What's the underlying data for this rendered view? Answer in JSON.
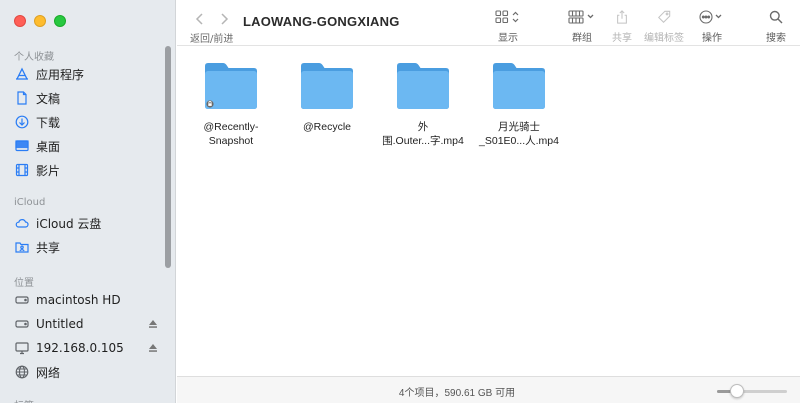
{
  "window": {
    "title": "LAOWANG-GONGXIANG",
    "nav_label": "返回/前进"
  },
  "toolbar": {
    "view_label": "显示",
    "group_label": "群组",
    "share_label": "共享",
    "tags_label": "编辑标签",
    "action_label": "操作",
    "search_label": "搜索"
  },
  "sidebar": {
    "favorites_header": "个人收藏",
    "favorites": [
      {
        "label": "应用程序",
        "icon": "applications-icon"
      },
      {
        "label": "文稿",
        "icon": "document-icon"
      },
      {
        "label": "下载",
        "icon": "downloads-icon"
      },
      {
        "label": "桌面",
        "icon": "desktop-icon"
      },
      {
        "label": "影片",
        "icon": "movies-icon"
      }
    ],
    "icloud_header": "iCloud",
    "icloud": [
      {
        "label": "iCloud 云盘",
        "icon": "icloud-icon"
      },
      {
        "label": "共享",
        "icon": "shared-folder-icon"
      }
    ],
    "locations_header": "位置",
    "locations": [
      {
        "label": "macintosh HD",
        "icon": "disk-icon"
      },
      {
        "label": "Untitled",
        "icon": "disk-icon"
      },
      {
        "label": "192.168.0.105",
        "icon": "display-icon"
      },
      {
        "label": "网络",
        "icon": "network-icon"
      }
    ],
    "tags_header": "标签"
  },
  "files": [
    {
      "name": "@Recently-\nSnapshot",
      "icon": "folder-icon"
    },
    {
      "name": "@Recycle",
      "icon": "folder-icon"
    },
    {
      "name": "外\n围.Outer...字.mp4",
      "icon": "folder-icon"
    },
    {
      "name": "月光骑士\n_S01E0...人.mp4",
      "icon": "folder-icon"
    }
  ],
  "status": {
    "text": "4个项目，590.61 GB 可用",
    "zoom_level": 0.28
  },
  "colors": {
    "accent": "#2a7df5",
    "folder": "#6cb8f2"
  }
}
